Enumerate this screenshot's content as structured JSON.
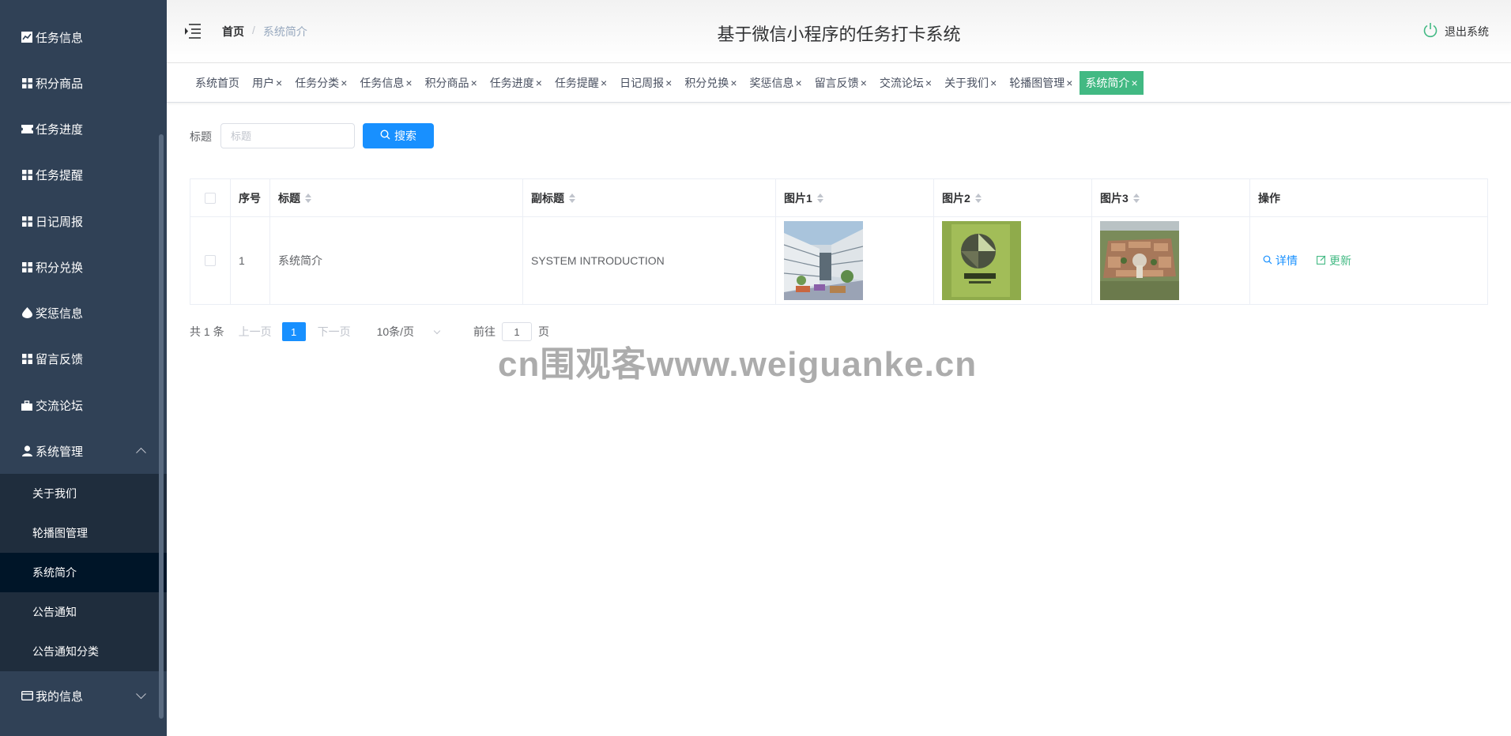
{
  "sidebar": {
    "items": [
      {
        "label": "任务信息",
        "icon": "chart-icon"
      },
      {
        "label": "积分商品",
        "icon": "grid-icon"
      },
      {
        "label": "任务进度",
        "icon": "ticket-icon"
      },
      {
        "label": "任务提醒",
        "icon": "grid-icon"
      },
      {
        "label": "日记周报",
        "icon": "grid-icon"
      },
      {
        "label": "积分兑换",
        "icon": "grid-icon"
      },
      {
        "label": "奖惩信息",
        "icon": "drop-icon"
      },
      {
        "label": "留言反馈",
        "icon": "grid-icon"
      },
      {
        "label": "交流论坛",
        "icon": "briefcase-icon"
      },
      {
        "label": "系统管理",
        "icon": "user-icon"
      },
      {
        "label": "我的信息",
        "icon": "card-icon"
      }
    ],
    "submenu": [
      {
        "label": "关于我们"
      },
      {
        "label": "轮播图管理"
      },
      {
        "label": "系统简介"
      },
      {
        "label": "公告通知"
      },
      {
        "label": "公告通知分类"
      }
    ]
  },
  "header": {
    "title": "基于微信小程序的任务打卡系统",
    "breadcrumb_home": "首页",
    "breadcrumb_sep": "/",
    "breadcrumb_current": "系统简介",
    "logout_label": "退出系统"
  },
  "tags": [
    {
      "label": "系统首页"
    },
    {
      "label": "用户"
    },
    {
      "label": "任务分类"
    },
    {
      "label": "任务信息"
    },
    {
      "label": "积分商品"
    },
    {
      "label": "任务进度"
    },
    {
      "label": "任务提醒"
    },
    {
      "label": "日记周报"
    },
    {
      "label": "积分兑换"
    },
    {
      "label": "奖惩信息"
    },
    {
      "label": "留言反馈"
    },
    {
      "label": "交流论坛"
    },
    {
      "label": "关于我们"
    },
    {
      "label": "轮播图管理"
    },
    {
      "label": "系统简介"
    }
  ],
  "tag_close": "×",
  "search": {
    "label": "标题",
    "placeholder": "标题",
    "button_label": "搜索"
  },
  "table": {
    "columns": [
      "序号",
      "标题",
      "副标题",
      "图片1",
      "图片2",
      "图片3",
      "操作"
    ],
    "rows": [
      {
        "index": "1",
        "title": "系统简介",
        "subtitle": "SYSTEM INTRODUCTION"
      }
    ],
    "detail_label": "详情",
    "update_label": "更新"
  },
  "pagination": {
    "total": "共 1 条",
    "prev": "上一页",
    "current_page": "1",
    "next": "下一页",
    "page_size": "10条/页",
    "goto_label": "前往",
    "goto_value": "1",
    "page_unit": "页"
  },
  "watermark": "cn围观客www.weiguanke.cn",
  "colors": {
    "sidebar_bg": "#304156",
    "submenu_bg": "#1f2d3d",
    "submenu_active_bg": "#001528",
    "primary": "#1890ff",
    "active_tag": "#42b983",
    "update_green": "#42b983"
  }
}
